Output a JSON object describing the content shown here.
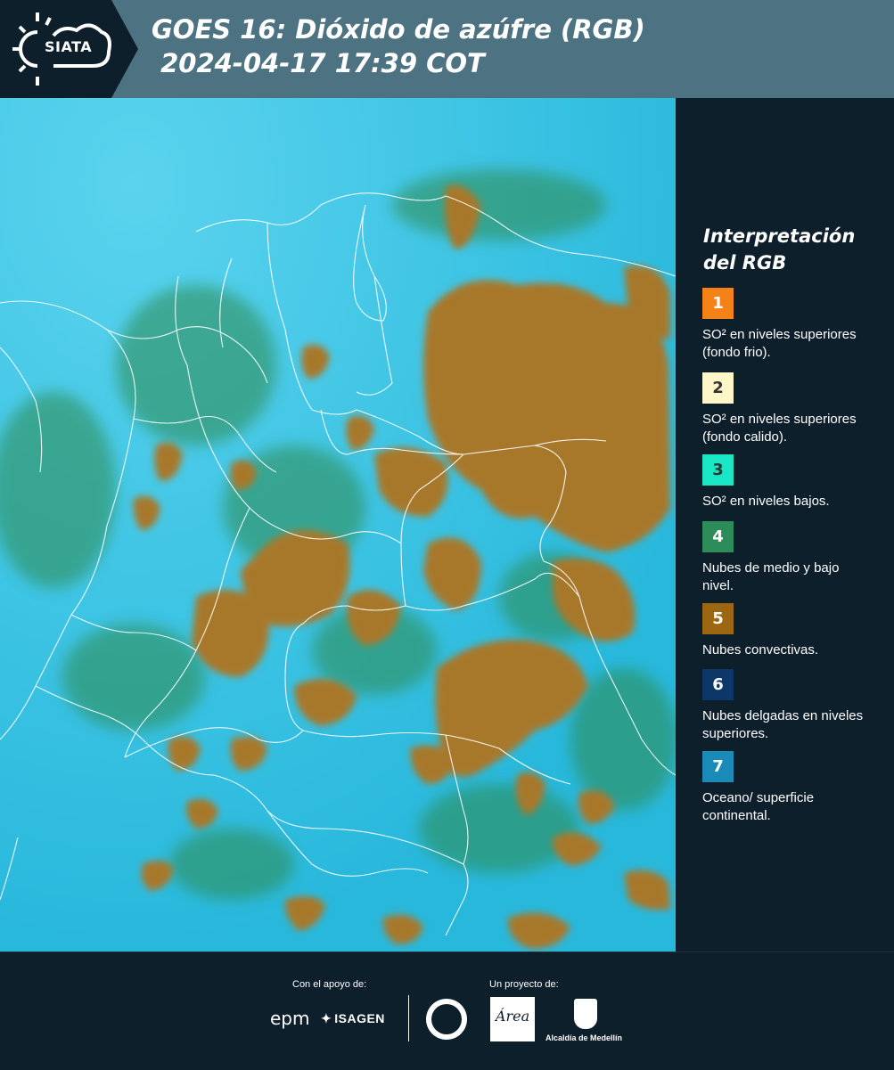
{
  "header": {
    "logo_text": "SIATA",
    "title_line1": "GOES 16: Dióxido de azúfre (RGB)",
    "title_line2": " 2024-04-17 17:39 COT"
  },
  "map": {
    "background_color": "#34c3e2",
    "cloud_color": "#a8782a",
    "low_cloud_color": "#2e8a4e",
    "border_color": "#ffffff"
  },
  "legend": {
    "title": "Interpretación del RGB",
    "items": [
      {
        "number": "1",
        "color": "#f58217",
        "label": "SO² en niveles superiores (fondo frio)."
      },
      {
        "number": "2",
        "color": "#fff7c7",
        "label": "SO² en niveles superiores (fondo calido)."
      },
      {
        "number": "3",
        "color": "#19e6c4",
        "label": "SO² en niveles bajos."
      },
      {
        "number": "4",
        "color": "#2d8d5a",
        "label": "Nubes de medio y bajo nivel."
      },
      {
        "number": "5",
        "color": "#9c6613",
        "label": "Nubes convectivas."
      },
      {
        "number": "6",
        "color": "#0e3769",
        "label": "Nubes delgadas en niveles superiores."
      },
      {
        "number": "7",
        "color": "#1a8bb8",
        "label": "Oceano/ superficie continental."
      }
    ]
  },
  "footer": {
    "support_label": "Con el apoyo de:",
    "project_label": "Un proyecto de:",
    "sponsor_epm": "epm",
    "sponsor_isagen": "ISAGEN",
    "partner_amva": "Área",
    "partner_alcaldia": "Alcaldía de Medellín"
  }
}
